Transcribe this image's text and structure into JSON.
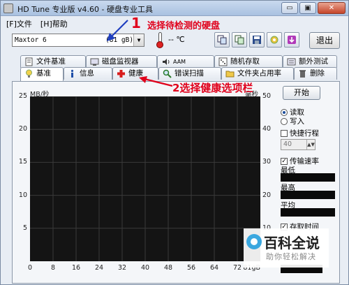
{
  "window": {
    "title": "HD Tune 专业版 v4.60 - 硬盘专业工具"
  },
  "window_controls": {
    "minimize": "▭",
    "maximize": "▣",
    "close": "✕"
  },
  "menu": {
    "file": "[F]文件",
    "help": "[H]帮助"
  },
  "toolbar": {
    "drive_name": "Maxtor 6",
    "drive_capacity": "(81 gB)",
    "dropdown_arrow": "▼",
    "temperature": "-- ℃",
    "exit_label": "退出",
    "buttons": [
      "copy-icon",
      "copy-all-icon",
      "save-icon",
      "options-icon",
      "download-icon"
    ]
  },
  "tabs_top": [
    {
      "label": "文件基准",
      "icon": "file-benchmark-icon"
    },
    {
      "label": "磁盘监视器",
      "icon": "disk-monitor-icon"
    },
    {
      "label": "AAM",
      "icon": "speaker-icon"
    },
    {
      "label": "随机存取",
      "icon": "random-access-icon"
    },
    {
      "label": "额外测试",
      "icon": "extra-tests-icon"
    }
  ],
  "tabs_bottom": [
    {
      "label": "基准",
      "icon": "benchmark-icon"
    },
    {
      "label": "信息",
      "icon": "info-icon"
    },
    {
      "label": "健康",
      "icon": "health-cross-icon"
    },
    {
      "label": "错误扫描",
      "icon": "magnifier-icon"
    },
    {
      "label": "文件夹占用率",
      "icon": "folder-icon"
    },
    {
      "label": "删除",
      "icon": "trash-icon"
    }
  ],
  "annotations": {
    "step1_num": "1",
    "step1_text": "选择待检测的硬盘",
    "step2_text": "2选择健康选项栏"
  },
  "side": {
    "start_label": "开始",
    "read_label": "读取",
    "write_label": "写入",
    "read_selected": true,
    "short_stroke_label": "快捷行程",
    "short_stroke_value": "40",
    "transfer_rate_label": "传输速率",
    "transfer_rate_checked": true,
    "min_label": "最低",
    "max_label": "最高",
    "avg_label": "平均",
    "access_time_label": "存取时间"
  },
  "chart_data": {
    "type": "line",
    "ylabel_left": "MB/秒",
    "ylabel_right": "毫秒",
    "left_ticks": [
      "25",
      "20",
      "15",
      "10",
      "5"
    ],
    "right_ticks": [
      "50",
      "40",
      "30",
      "20",
      "10"
    ],
    "x_ticks": [
      "0",
      "8",
      "16",
      "24",
      "32",
      "40",
      "48",
      "56",
      "64",
      "72",
      "81gB"
    ],
    "ylim_left": [
      0,
      25
    ],
    "ylim_right": [
      0,
      50
    ],
    "xlim": [
      0,
      81
    ],
    "grid": true,
    "series": []
  },
  "watermark": {
    "title": "百科全说",
    "subtitle": "助你轻松解决"
  },
  "colors": {
    "annotation": "#e0001b",
    "chart_bg": "#141414",
    "grid": "#3a3a3a"
  }
}
